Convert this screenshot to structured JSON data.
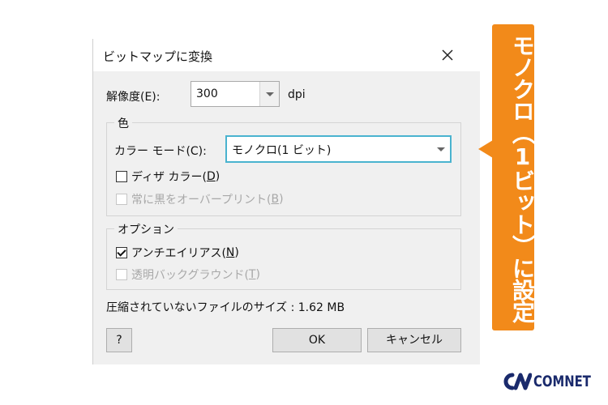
{
  "dialog": {
    "title": "ビットマップに変換",
    "resolution": {
      "label": "解像度(E):",
      "value": "300",
      "unit": "dpi"
    },
    "color_group": {
      "legend": "色",
      "color_mode": {
        "label": "カラー モード(C):",
        "value": "モノクロ(1 ビット)"
      },
      "dither": {
        "label_prefix": "ディザ カラー(",
        "key": "D",
        "label_suffix": ")",
        "checked": false,
        "enabled": true
      },
      "overprint_black": {
        "label_prefix": "常に黒をオーバープリント(",
        "key": "B",
        "label_suffix": ")",
        "checked": false,
        "enabled": false
      }
    },
    "options_group": {
      "legend": "オプション",
      "antialiasing": {
        "label_prefix": "アンチエイリアス(",
        "key": "N",
        "label_suffix": ")",
        "checked": true,
        "enabled": true
      },
      "transparent_bg": {
        "label_prefix": "透明バックグラウンド(",
        "key": "T",
        "label_suffix": ")",
        "checked": false,
        "enabled": false
      }
    },
    "uncompressed_size": "圧縮されていないファイルのサイズ : 1.62 MB",
    "buttons": {
      "help": "?",
      "ok": "OK",
      "cancel": "キャンセル"
    }
  },
  "callout": {
    "text": "モノクロ（1ビット）に設定",
    "color": "#f28a1a"
  },
  "brand": {
    "name": "COMNET",
    "color": "#1a2a6c"
  }
}
